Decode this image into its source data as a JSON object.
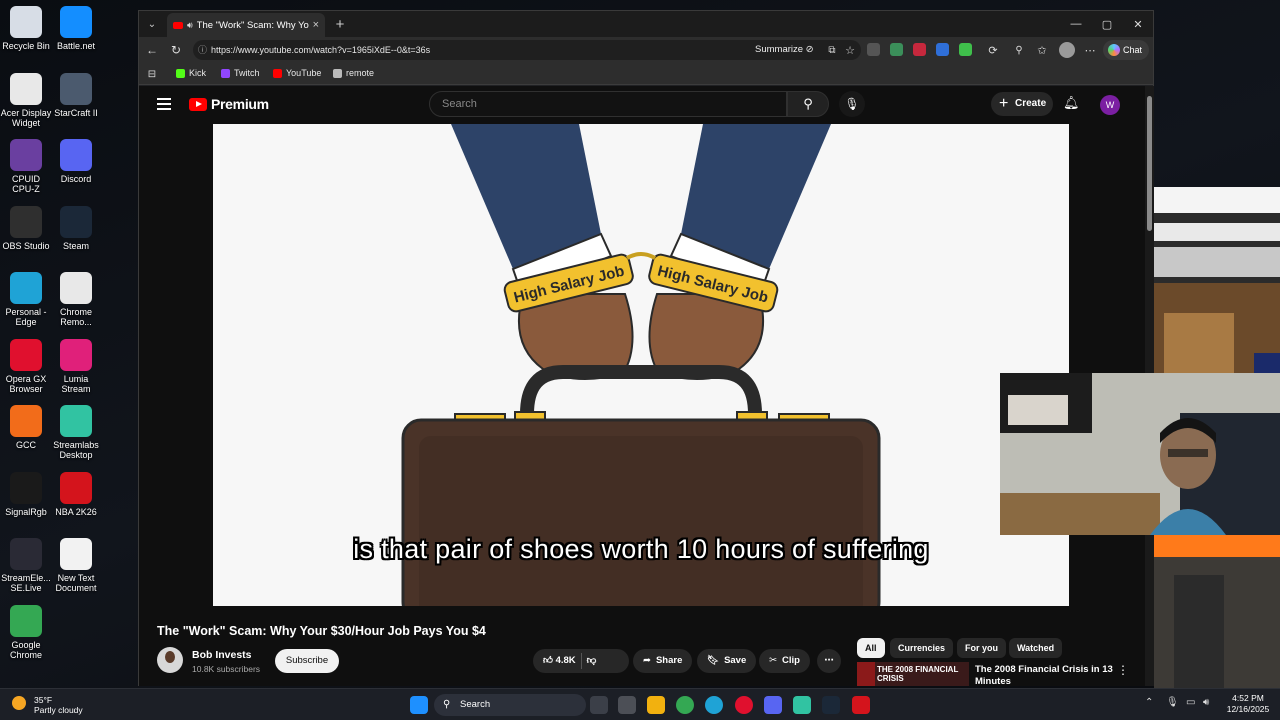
{
  "desktop": {
    "icons": [
      {
        "label": "Recycle Bin",
        "icon": "recycle-bin-icon",
        "color": "#d7dde6"
      },
      {
        "label": "Battle.net",
        "icon": "battlenet-icon",
        "color": "#148eff"
      },
      {
        "label": "Acer Display Widget",
        "icon": "acer-icon",
        "color": "#e8e8e8"
      },
      {
        "label": "StarCraft II",
        "icon": "starcraft-icon",
        "color": "#4b5a6e"
      },
      {
        "label": "CPUID CPU-Z",
        "icon": "cpuz-icon",
        "color": "#6a3fa0"
      },
      {
        "label": "Discord",
        "icon": "discord-icon",
        "color": "#5865f2"
      },
      {
        "label": "OBS Studio",
        "icon": "obs-icon",
        "color": "#2f2f2f"
      },
      {
        "label": "Steam",
        "icon": "steam-icon",
        "color": "#1b2838"
      },
      {
        "label": "Personal - Edge",
        "icon": "edge-icon",
        "color": "#1fa3d6"
      },
      {
        "label": "Chrome Remo...",
        "icon": "chrome-remote-icon",
        "color": "#e8e8e8"
      },
      {
        "label": "Opera GX Browser",
        "icon": "opera-gx-icon",
        "color": "#e0102e"
      },
      {
        "label": "Lumia Stream",
        "icon": "lumia-icon",
        "color": "#e0207a"
      },
      {
        "label": "GCC",
        "icon": "gcc-icon",
        "color": "#f26c1a"
      },
      {
        "label": "Streamlabs Desktop",
        "icon": "streamlabs-icon",
        "color": "#31c3a2"
      },
      {
        "label": "SignalRgb",
        "icon": "signalrgb-icon",
        "color": "#1a1a1a"
      },
      {
        "label": "NBA 2K26",
        "icon": "nba2k-icon",
        "color": "#d4141c"
      },
      {
        "label": "StreamEle... SE.Live",
        "icon": "streamelements-icon",
        "color": "#2a2a35"
      },
      {
        "label": "New Text Document",
        "icon": "text-document-icon",
        "color": "#f2f2f2"
      },
      {
        "label": "Google Chrome",
        "icon": "chrome-icon",
        "color": "#34a853"
      }
    ]
  },
  "browser": {
    "tab_title": "The \"Work\" Scam: Why Your $...",
    "new_tab": "+",
    "url": "https://www.youtube.com/watch?v=1965iXdE--0&t=36s",
    "summarize_label": "Summarize",
    "chat_label": "Chat",
    "bookmarks": [
      {
        "label": "Kick",
        "color": "#53fc18"
      },
      {
        "label": "Twitch",
        "color": "#9146ff"
      },
      {
        "label": "YouTube",
        "color": "#ff0000"
      },
      {
        "label": "remote",
        "color": "#bbbbbb"
      }
    ]
  },
  "youtube": {
    "logo_text": "Premium",
    "search_placeholder": "Search",
    "create_label": "Create",
    "avatar_letter": "W",
    "caption": "is that pair of shoes worth 10 hours of suffering",
    "handcuff_text": "High Salary Job",
    "video_title": "The \"Work\" Scam: Why Your $30/Hour Job Pays You $4",
    "channel_name": "Bob Invests",
    "subscribers": "10.8K subscribers",
    "subscribe_label": "Subscribe",
    "likes": "4.8K",
    "share_label": "Share",
    "save_label": "Save",
    "clip_label": "Clip",
    "chips": [
      "All",
      "Currencies",
      "For you",
      "Watched"
    ],
    "rec_thumb_text": "THE 2008 FINANCIAL CRISIS",
    "rec_title": "The 2008 Financial Crisis in 13 Minutes"
  },
  "taskbar": {
    "weather_temp": "35°F",
    "weather_desc": "Partly cloudy",
    "search_label": "Search",
    "time": "4:52 PM",
    "date": "12/16/2025"
  },
  "colors": {
    "youtube_red": "#ff0000",
    "cuff_gold": "#f2c12e",
    "briefcase": "#4a3328",
    "suit_blue": "#2d4368"
  }
}
